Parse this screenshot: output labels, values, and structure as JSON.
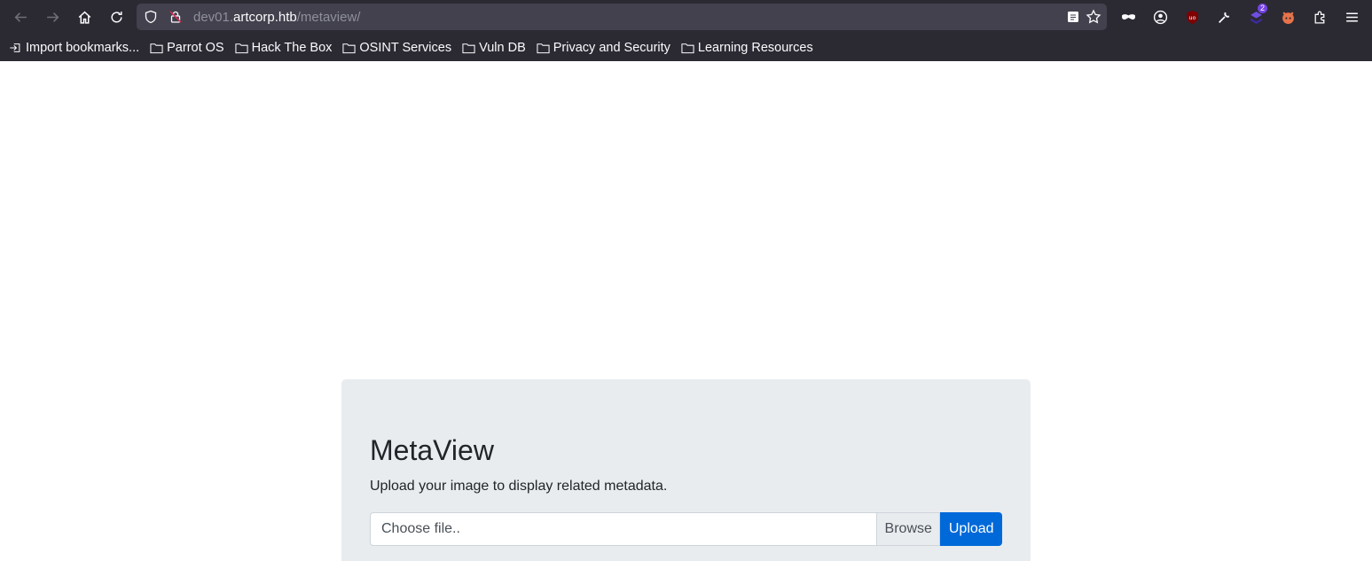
{
  "browser": {
    "url_prefix": "dev01.",
    "url_host": "artcorp.htb",
    "url_path": "/metaview/",
    "extension_badge": "2",
    "bookmarks": [
      {
        "label": "Import bookmarks...",
        "icon": "import-icon"
      },
      {
        "label": "Parrot OS",
        "icon": "folder-icon"
      },
      {
        "label": "Hack The Box",
        "icon": "folder-icon"
      },
      {
        "label": "OSINT Services",
        "icon": "folder-icon"
      },
      {
        "label": "Vuln DB",
        "icon": "folder-icon"
      },
      {
        "label": "Privacy and Security",
        "icon": "folder-icon"
      },
      {
        "label": "Learning Resources",
        "icon": "folder-icon"
      }
    ]
  },
  "page": {
    "title": "MetaView",
    "lead": "Upload your image to display related metadata.",
    "file_placeholder": "Choose file..",
    "browse_label": "Browse",
    "upload_label": "Upload"
  },
  "colors": {
    "chrome_bg": "#2b2a33",
    "urlbar_bg": "#42414d",
    "jumbotron_bg": "#e9ecef",
    "primary_button": "#0069d9"
  }
}
